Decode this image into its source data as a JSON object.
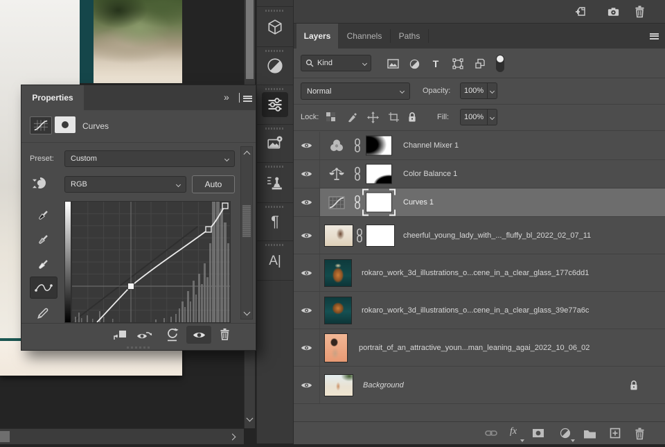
{
  "colors": {
    "panel_bg": "#4d4d4d",
    "tab_bar": "#383838",
    "selected_row": "#6d6d6d",
    "pasteboard": "#242424",
    "control_bg": "#424242",
    "accent_teal": "#15464a",
    "curve_line": "#eaeaea"
  },
  "dock": {
    "icons": [
      "3d-panel",
      "adjustments-panel",
      "properties-panel",
      "libraries-panel",
      "clone-source-panel",
      "paragraph-panel",
      "character-panel"
    ],
    "selected": "properties-panel"
  },
  "properties_panel": {
    "tab_label": "Properties",
    "adjustment_type_label": "Curves",
    "preset_label": "Preset:",
    "preset_value": "Custom",
    "channel_value": "RGB",
    "auto_button_label": "Auto",
    "tools": [
      "black-point-eyedropper",
      "gray-point-eyedropper",
      "white-point-eyedropper",
      "curve-point-tool",
      "pencil-tool"
    ],
    "curve": {
      "channel": "RGB",
      "control_points_0_255": [
        [
          42,
          0
        ],
        [
          95,
          76
        ],
        [
          220,
          196
        ],
        [
          246,
          248
        ]
      ],
      "selected_point_index": 1,
      "histogram_peak_region_0_255": [
        225,
        255
      ]
    },
    "footer_icons": [
      "clip-to-layer",
      "visibility-history",
      "reset",
      "toggle-visibility",
      "delete-adjustment"
    ]
  },
  "layers_panel": {
    "header_icons": [
      "add-layer-comp",
      "camera-snapshot",
      "delete"
    ],
    "tabs": [
      {
        "label": "Layers",
        "active": true
      },
      {
        "label": "Channels",
        "active": false
      },
      {
        "label": "Paths",
        "active": false
      }
    ],
    "filter": {
      "kind_label": "Kind",
      "type_icons": [
        "pixel-layer-filter",
        "adjustment-layer-filter",
        "type-layer-filter",
        "shape-layer-filter",
        "smart-object-filter"
      ],
      "toggle": "filtering-on"
    },
    "blend_mode_value": "Normal",
    "opacity_label": "Opacity:",
    "opacity_value": "100%",
    "lock_label": "Lock:",
    "lock_icons": [
      "lock-transparent-pixels",
      "lock-image-pixels",
      "lock-position",
      "lock-artboard-nesting",
      "lock-all"
    ],
    "fill_label": "Fill:",
    "fill_value": "100%",
    "fx_label": "fx",
    "layers": [
      {
        "name": "Channel Mixer 1",
        "kind": "adjustment",
        "adjustment": "channel-mixer",
        "visible": true,
        "selected": false
      },
      {
        "name": "Color Balance 1",
        "kind": "adjustment",
        "adjustment": "color-balance",
        "visible": true,
        "selected": false
      },
      {
        "name": "Curves 1",
        "kind": "adjustment",
        "adjustment": "curves",
        "visible": true,
        "selected": true
      },
      {
        "name": "cheerful_young_lady_with_..._fluffy_bl_2022_02_07_11",
        "kind": "image",
        "visible": true,
        "has_mask": true,
        "selected": false
      },
      {
        "name": "rokaro_work_3d_illustrations_o...cene_in_a_clear_glass_177c6dd1",
        "kind": "image",
        "visible": true,
        "selected": false
      },
      {
        "name": "rokaro_work_3d_illustrations_o...cene_in_a_clear_glass_39e77a6c",
        "kind": "image",
        "visible": true,
        "selected": false
      },
      {
        "name": "portrait_of_an_attractive_youn...man_leaning_agai_2022_10_06_02",
        "kind": "image",
        "visible": true,
        "selected": false
      },
      {
        "name": "Background",
        "kind": "background",
        "visible": true,
        "locked": true,
        "selected": false
      }
    ],
    "footer_icons": [
      "link-layers",
      "layer-style-fx",
      "add-layer-mask",
      "new-adjustment-layer",
      "new-group",
      "new-layer",
      "delete-layer"
    ]
  }
}
